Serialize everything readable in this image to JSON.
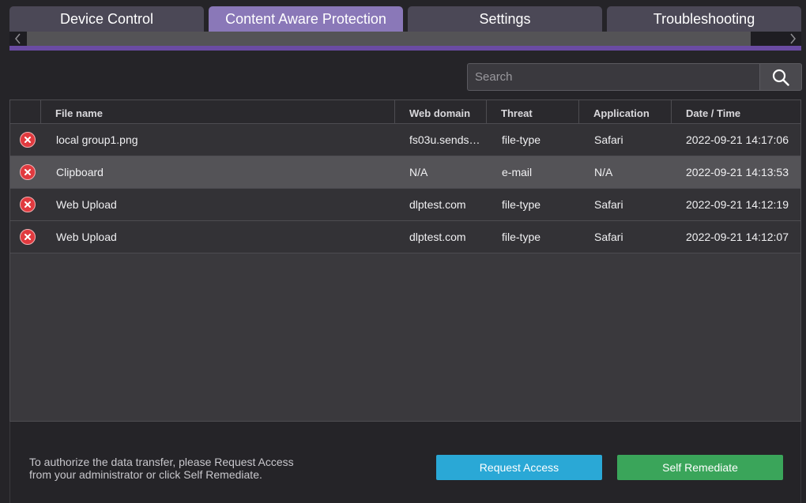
{
  "tabs": [
    {
      "label": "Device Control",
      "active": false
    },
    {
      "label": "Content Aware Protection",
      "active": true
    },
    {
      "label": "Settings",
      "active": false
    },
    {
      "label": "Troubleshooting",
      "active": false
    }
  ],
  "search": {
    "placeholder": "Search",
    "value": ""
  },
  "table": {
    "columns": [
      "File name",
      "Web domain",
      "Threat",
      "Application",
      "Date / Time"
    ],
    "rows": [
      {
        "status_icon": "blocked-icon",
        "file_name": "local group1.png",
        "web_domain": "fs03u.sends…",
        "threat": "file-type",
        "application": "Safari",
        "datetime": "2022-09-21 14:17:06"
      },
      {
        "status_icon": "blocked-icon",
        "file_name": "Clipboard",
        "web_domain": "N/A",
        "threat": "e-mail",
        "application": "N/A",
        "datetime": "2022-09-21 14:13:53"
      },
      {
        "status_icon": "blocked-icon",
        "file_name": "Web Upload",
        "web_domain": "dlptest.com",
        "threat": "file-type",
        "application": "Safari",
        "datetime": "2022-09-21 14:12:19"
      },
      {
        "status_icon": "blocked-icon",
        "file_name": "Web Upload",
        "web_domain": "dlptest.com",
        "threat": "file-type",
        "application": "Safari",
        "datetime": "2022-09-21 14:12:07"
      }
    ]
  },
  "footer": {
    "message_line1": "To authorize the data transfer, please Request Access",
    "message_line2": "from your administrator or click Self Remediate.",
    "request_access_label": "Request Access",
    "self_remediate_label": "Self Remediate"
  },
  "colors": {
    "active_tab": "#8a78b8",
    "accent_bar": "#6a4ba2",
    "request_button": "#2aa8d6",
    "remediate_button": "#3aa55a",
    "blocked_badge": "#e13a3f"
  }
}
